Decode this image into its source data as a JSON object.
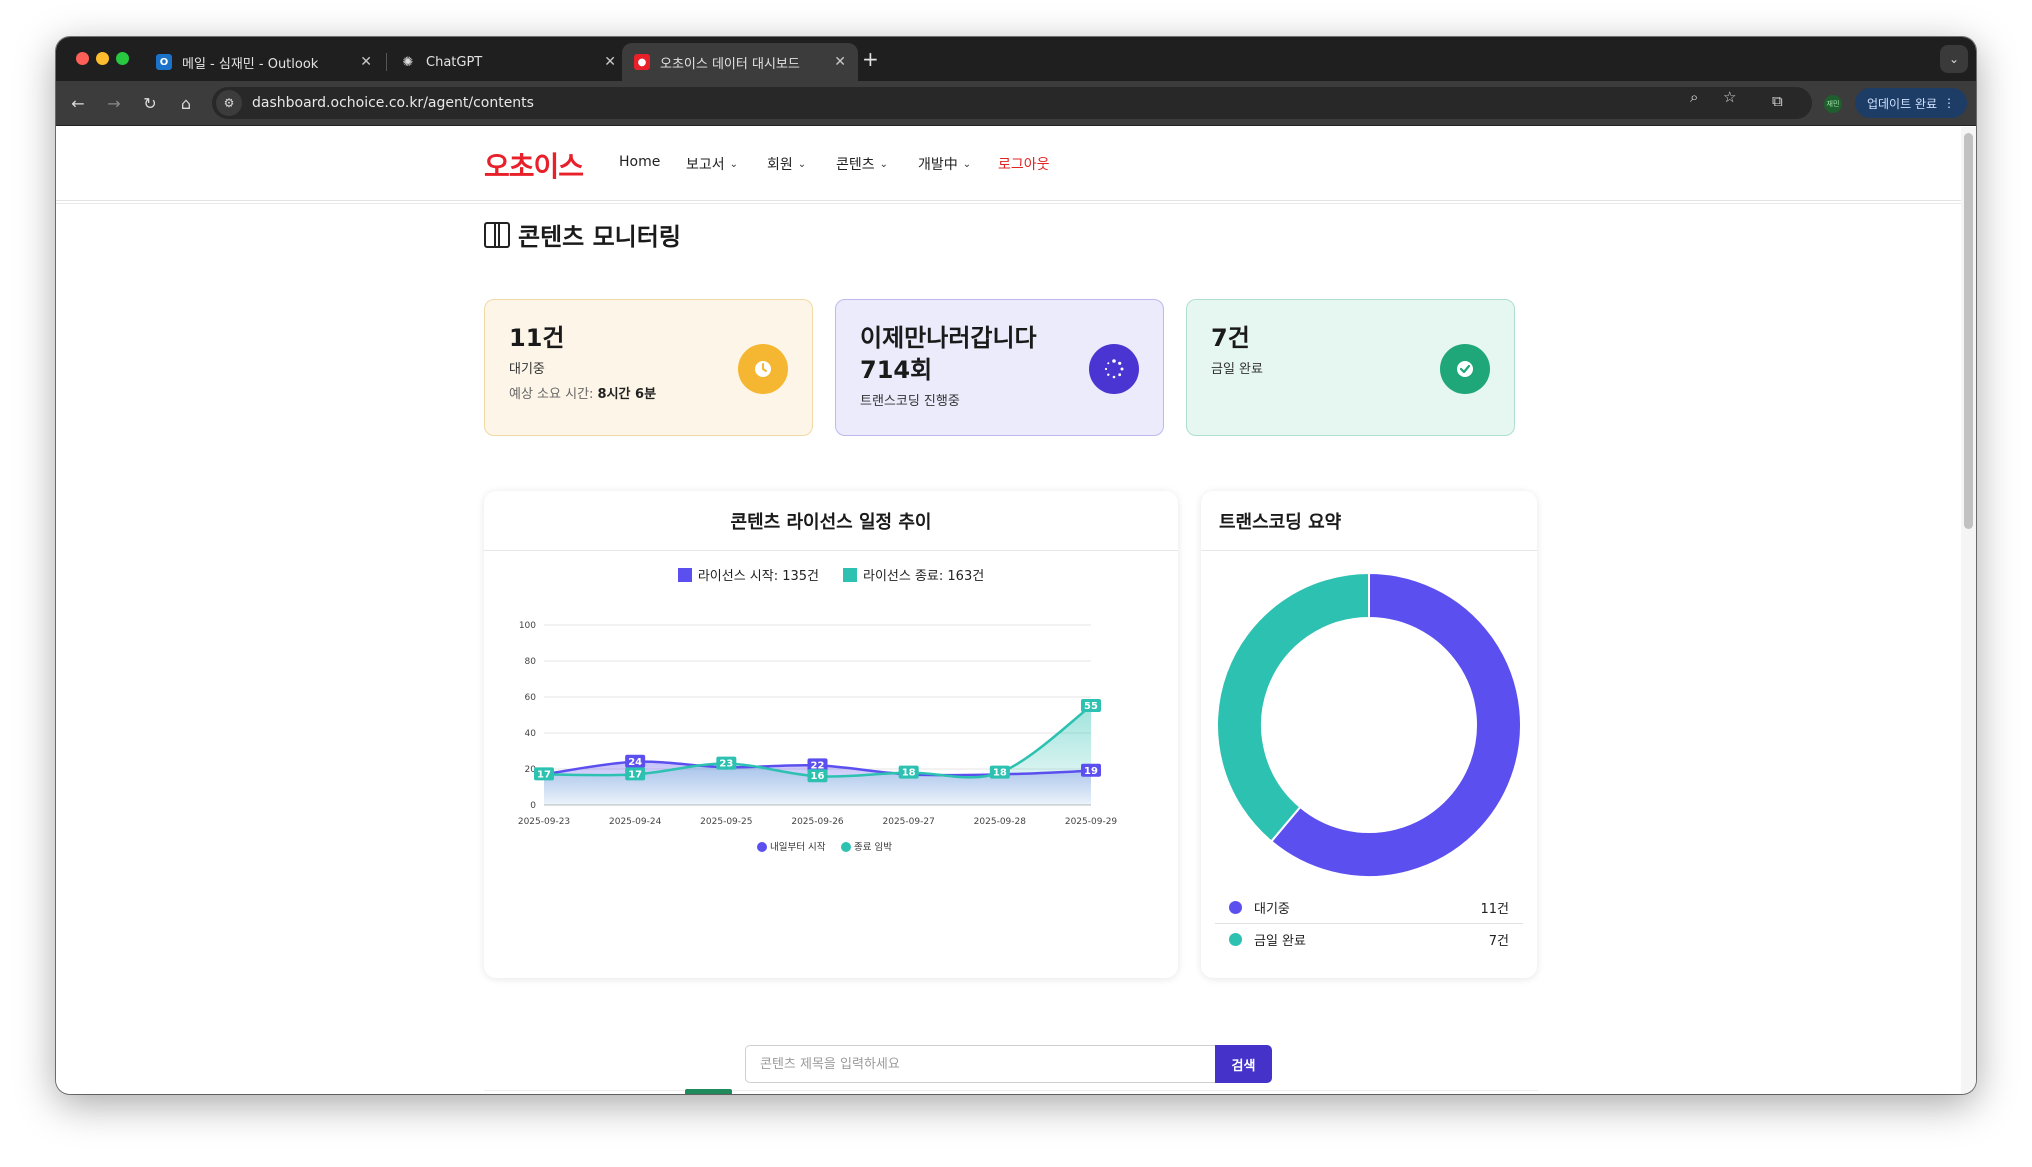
{
  "browser": {
    "tabs": [
      {
        "title": "메일 - 심재민 - Outlook",
        "favicon": "outlook-icon",
        "active": false
      },
      {
        "title": "ChatGPT",
        "favicon": "chatgpt-icon",
        "active": false
      },
      {
        "title": "오초이스 데이터 대시보드",
        "favicon": "ochoice-icon",
        "active": true
      }
    ],
    "url": "dashboard.ochoice.co.kr/agent/contents",
    "profile_label": "재민",
    "update_label": "업데이트 완료"
  },
  "nav": {
    "logo": "오초이스",
    "items": [
      {
        "label": "Home",
        "dropdown": false
      },
      {
        "label": "보고서",
        "dropdown": true
      },
      {
        "label": "회원",
        "dropdown": true
      },
      {
        "label": "콘텐츠",
        "dropdown": true
      },
      {
        "label": "개발中",
        "dropdown": true
      }
    ],
    "logout": "로그아웃"
  },
  "page": {
    "title": "콘텐츠 모니터링"
  },
  "cards": [
    {
      "value": "11건",
      "label": "대기중",
      "extra_label": "예상 소요 시간:",
      "extra_value": "8시간 6분",
      "color": "#f5b731",
      "icon": "clock-icon"
    },
    {
      "value": "이제만나러갑니다 714회",
      "label": "트랜스코딩 진행중",
      "color": "#4a35d2",
      "icon": "spinner-icon"
    },
    {
      "value": "7건",
      "label": "금일 완료",
      "color": "#1fa77a",
      "icon": "check-circle-icon"
    }
  ],
  "chart_panel": {
    "title": "콘텐츠 라이선스 일정 추이",
    "legend_top": [
      {
        "label": "라이선스 시작: 135건",
        "color": "#5b4ff0"
      },
      {
        "label": "라이선스 종료: 163건",
        "color": "#2cc1b1"
      }
    ]
  },
  "chart_data": {
    "type": "area",
    "categories": [
      "2025-09-23",
      "2025-09-24",
      "2025-09-25",
      "2025-09-26",
      "2025-09-27",
      "2025-09-28",
      "2025-09-29"
    ],
    "series": [
      {
        "name": "내일부터 시작",
        "values": [
          17,
          24,
          21,
          22,
          17,
          17,
          19
        ],
        "color": "#5b4ff0"
      },
      {
        "name": "종료 임박",
        "values": [
          17,
          17,
          23,
          16,
          18,
          18,
          55
        ],
        "color": "#2cc1b1"
      }
    ],
    "data_labels": [
      {
        "series": 1,
        "index": 0,
        "text": "17"
      },
      {
        "series": 0,
        "index": 1,
        "text": "24"
      },
      {
        "series": 1,
        "index": 1,
        "text": "17"
      },
      {
        "series": 1,
        "index": 2,
        "text": "23"
      },
      {
        "series": 0,
        "index": 3,
        "text": "22"
      },
      {
        "series": 1,
        "index": 3,
        "text": "16"
      },
      {
        "series": 1,
        "index": 4,
        "text": "18"
      },
      {
        "series": 1,
        "index": 5,
        "text": "18"
      },
      {
        "series": 1,
        "index": 6,
        "text": "55"
      },
      {
        "series": 0,
        "index": 6,
        "text": "19"
      }
    ],
    "yticks": [
      0,
      20,
      40,
      60,
      80,
      100
    ],
    "ylim": [
      0,
      100
    ],
    "grid": true,
    "legend": "bottom"
  },
  "donut_panel": {
    "title": "트랜스코딩 요약",
    "items": [
      {
        "label": "대기중",
        "value": 11,
        "value_label": "11건",
        "color": "#5b4ff0"
      },
      {
        "label": "금일 완료",
        "value": 7,
        "value_label": "7건",
        "color": "#2cc1b1"
      }
    ]
  },
  "search": {
    "placeholder": "콘텐츠 제목을 입력하세요",
    "button_label": "검색"
  }
}
